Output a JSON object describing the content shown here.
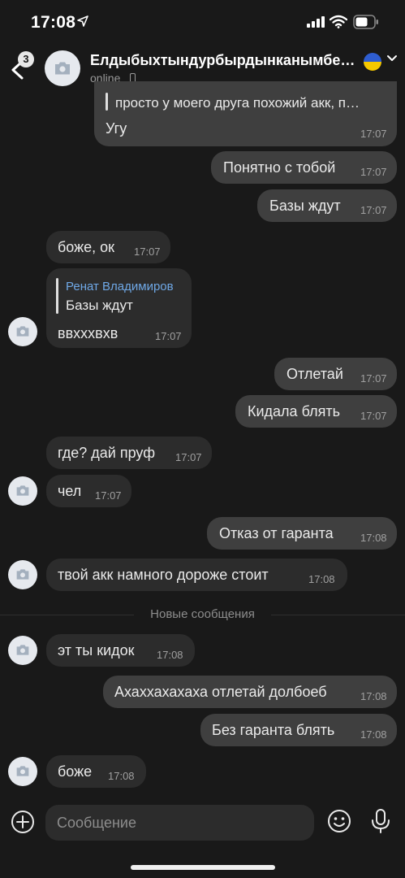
{
  "status_bar": {
    "time": "17:08"
  },
  "header": {
    "back_badge": "3",
    "title": "Елдыбыхтындурбырдынканымбе…",
    "status": "online"
  },
  "messages": [
    {
      "dir": "out",
      "quote": "просто у моего друга похожий акк, п…",
      "text": "Угу",
      "time": "17:07"
    },
    {
      "dir": "out",
      "text": "Понятно с тобой",
      "time": "17:07"
    },
    {
      "dir": "out",
      "text": "Базы ждут",
      "time": "17:07"
    },
    {
      "dir": "in",
      "text": "боже, ок",
      "time": "17:07"
    },
    {
      "dir": "in",
      "reply_name": "Ренат Владимиров",
      "reply_text": "Базы ждут",
      "text": "ввхххвхв",
      "time": "17:07"
    },
    {
      "dir": "out",
      "text": "Отлетай",
      "time": "17:07"
    },
    {
      "dir": "out",
      "text": "Кидала блять",
      "time": "17:07"
    },
    {
      "dir": "in",
      "text": "где? дай пруф",
      "time": "17:07"
    },
    {
      "dir": "in",
      "text": "чел",
      "time": "17:07"
    },
    {
      "dir": "out",
      "text": "Отказ от гаранта",
      "time": "17:08"
    },
    {
      "dir": "in",
      "text": "твой акк намного дороже стоит",
      "time": "17:08"
    },
    {
      "dir": "in",
      "text": "эт ты кидок",
      "time": "17:08"
    },
    {
      "dir": "out",
      "text": "Ахаххахахаха отлетай долбоеб",
      "time": "17:08"
    },
    {
      "dir": "out",
      "text": "Без гаранта блять",
      "time": "17:08"
    },
    {
      "dir": "in",
      "text": "боже",
      "time": "17:08"
    }
  ],
  "new_messages_divider": "Новые сообщения",
  "composer": {
    "placeholder": "Сообщение"
  },
  "colors": {
    "background": "#191919",
    "incoming_bubble": "#2c2c2c",
    "outgoing_bubble": "#3f3f3f",
    "reply_name": "#6fa8e6"
  },
  "icons": [
    "location-arrow-icon",
    "signal-icon",
    "wifi-icon",
    "battery-icon",
    "back-chevron-icon",
    "camera-icon",
    "phone-device-icon",
    "chevron-down-icon",
    "plus-circle-icon",
    "emoji-icon",
    "microphone-icon"
  ]
}
